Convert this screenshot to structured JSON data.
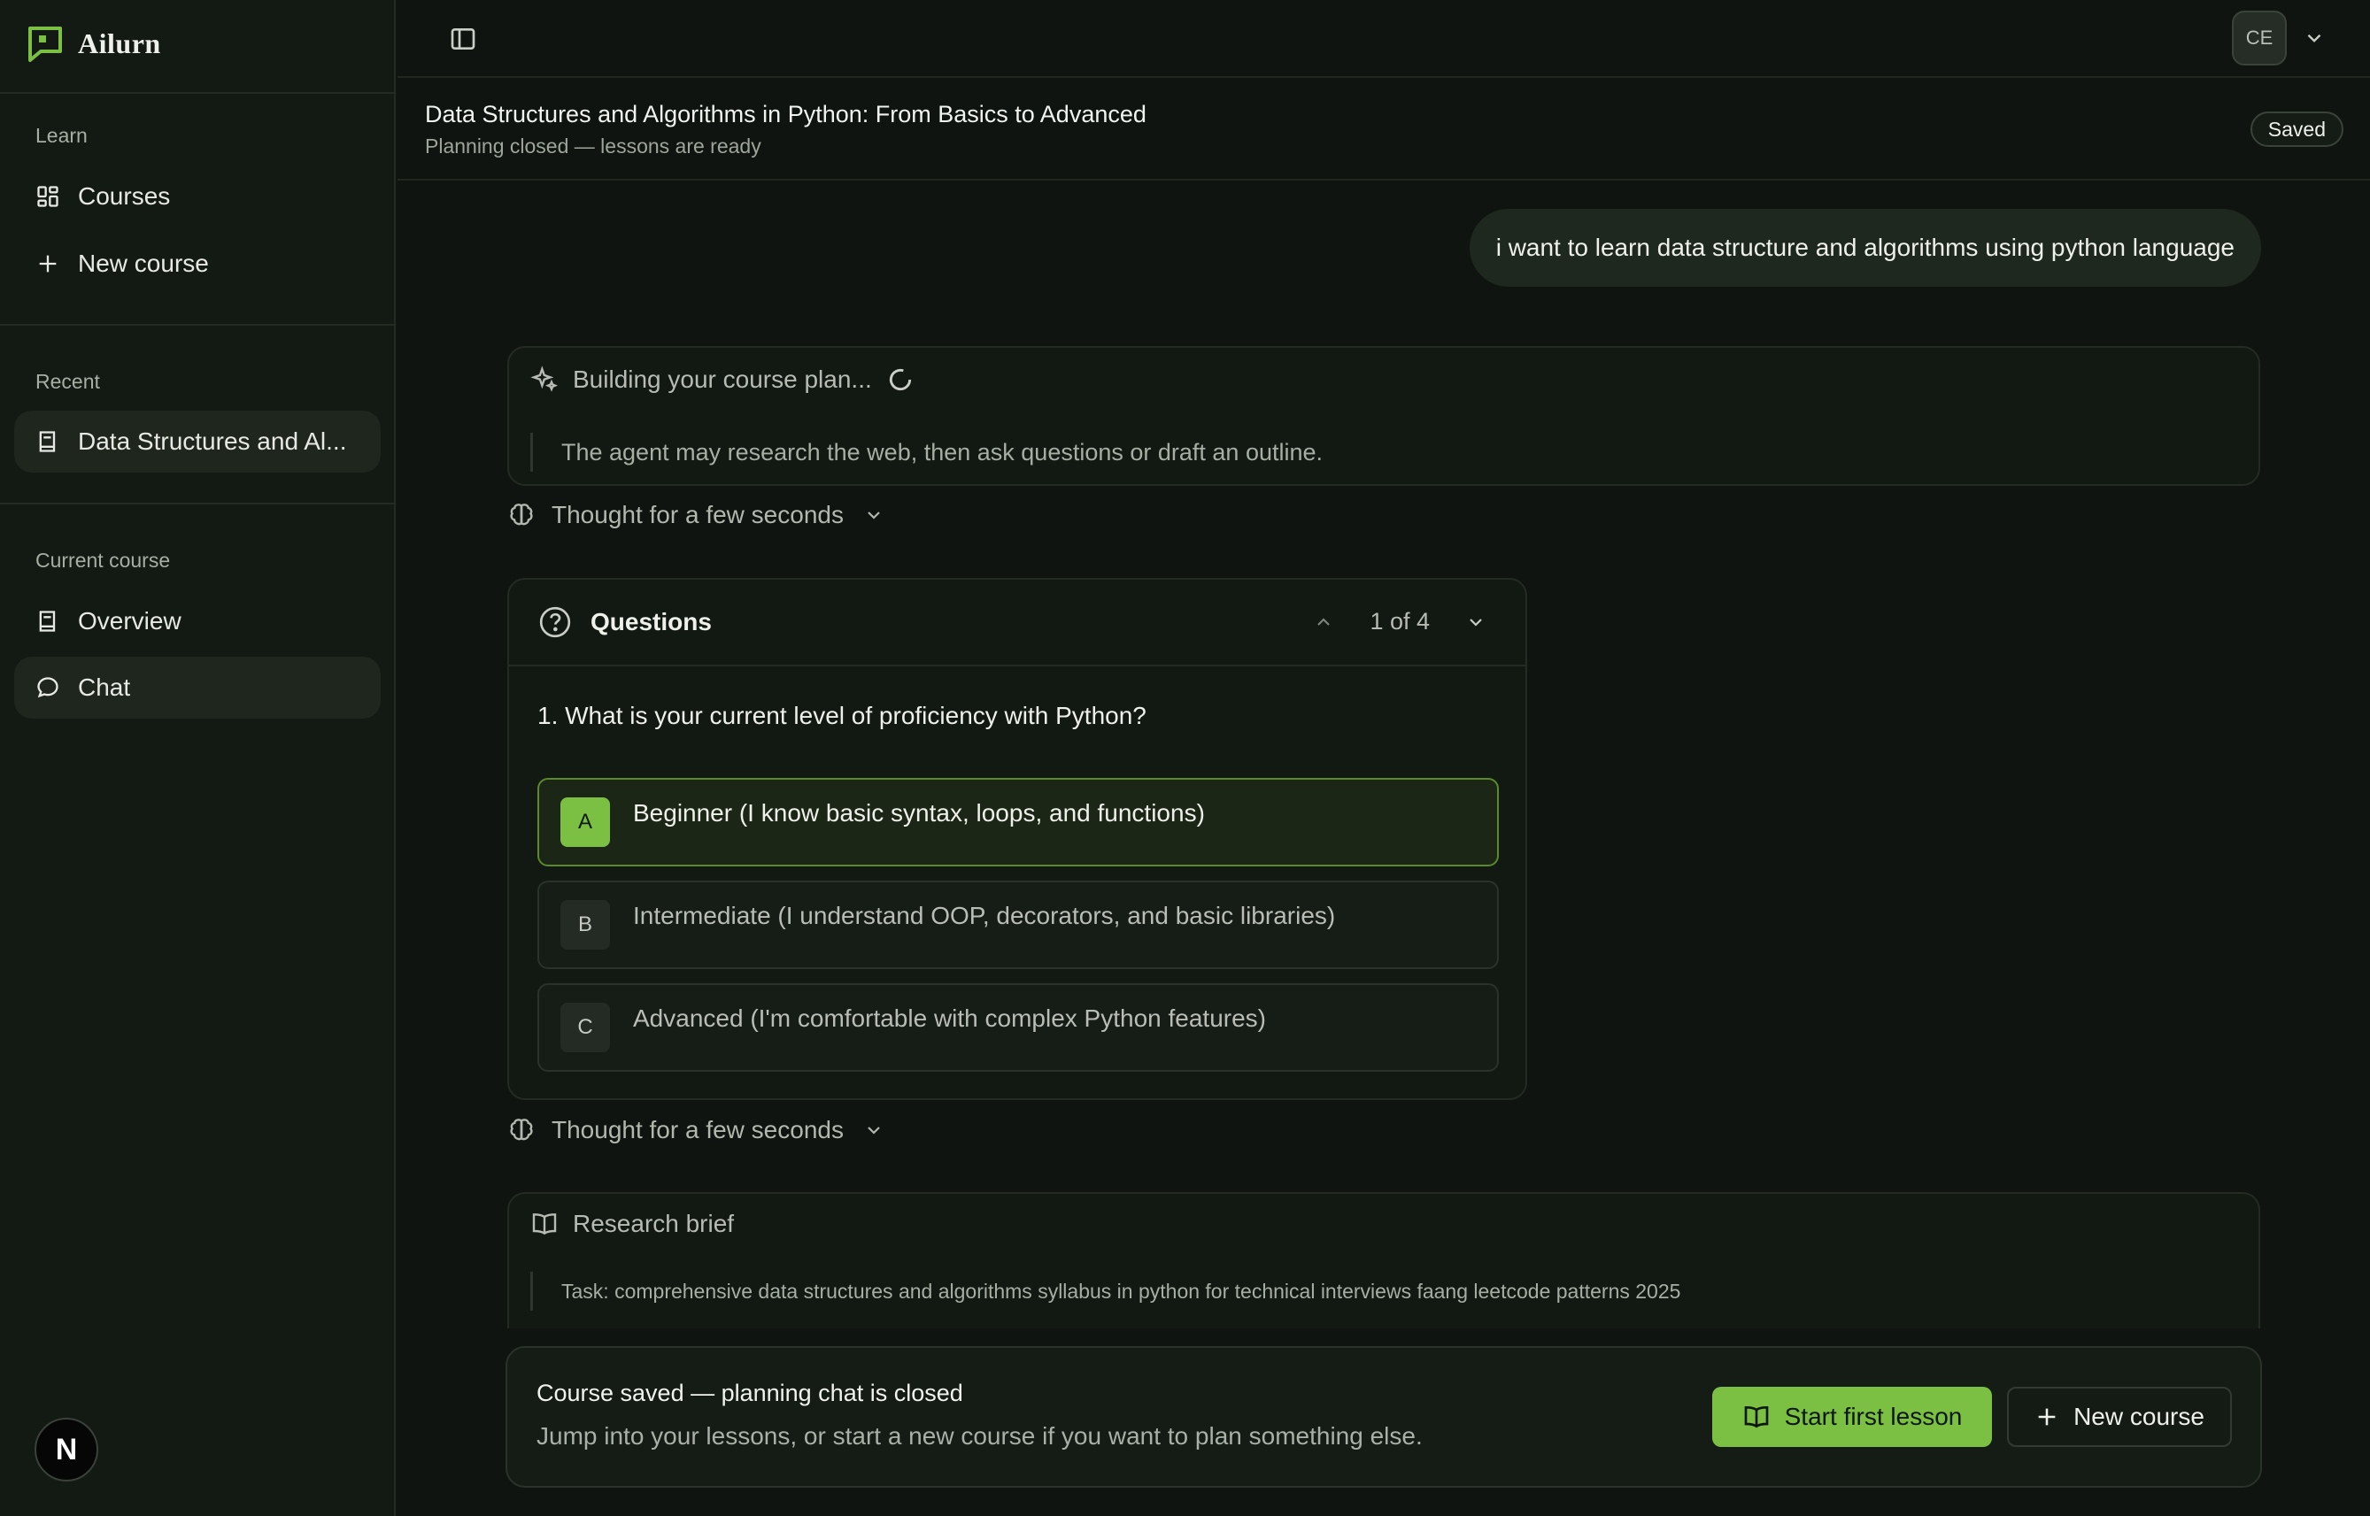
{
  "brand": {
    "name": "Ailurn",
    "accent": "#7bc043"
  },
  "sidebar": {
    "learn_label": "Learn",
    "learn_items": [
      {
        "label": "Courses",
        "icon": "grid-icon"
      },
      {
        "label": "New course",
        "icon": "plus-icon"
      }
    ],
    "recent_label": "Recent",
    "recent_items": [
      {
        "label": "Data Structures and Al...",
        "icon": "book-icon"
      }
    ],
    "current_label": "Current course",
    "current_items": [
      {
        "label": "Overview",
        "icon": "book-icon"
      },
      {
        "label": "Chat",
        "icon": "chat-bubble-icon"
      }
    ],
    "bottom_avatar": "N"
  },
  "topbar": {
    "user_initials": "CE"
  },
  "course": {
    "title": "Data Structures and Algorithms in Python: From Basics to Advanced",
    "subtitle": "Planning closed — lessons are ready",
    "status": "Saved"
  },
  "chat": {
    "user_message": "i want to learn data structure and algorithms using python language",
    "plan": {
      "heading": "Building your course plan...",
      "note": "The agent may research the web, then ask questions or draft an outline."
    },
    "thought_label": "Thought for a few seconds",
    "questions": {
      "heading": "Questions",
      "pager": "1 of 4",
      "question": "1. What is your current level of proficiency with Python?",
      "options": [
        {
          "letter": "A",
          "text": "Beginner (I know basic syntax, loops, and functions)"
        },
        {
          "letter": "B",
          "text": "Intermediate (I understand OOP, decorators, and basic libraries)"
        },
        {
          "letter": "C",
          "text": "Advanced (I'm comfortable with complex Python features)"
        }
      ]
    },
    "research": {
      "heading": "Research brief",
      "task": "Task: comprehensive data structures and algorithms syllabus in python for technical interviews faang leetcode patterns 2025"
    }
  },
  "footer": {
    "title": "Course saved — planning chat is closed",
    "subtitle": "Jump into your lessons, or start a new course if you want to plan something else.",
    "primary_button": "Start first lesson",
    "secondary_button": "New course"
  }
}
